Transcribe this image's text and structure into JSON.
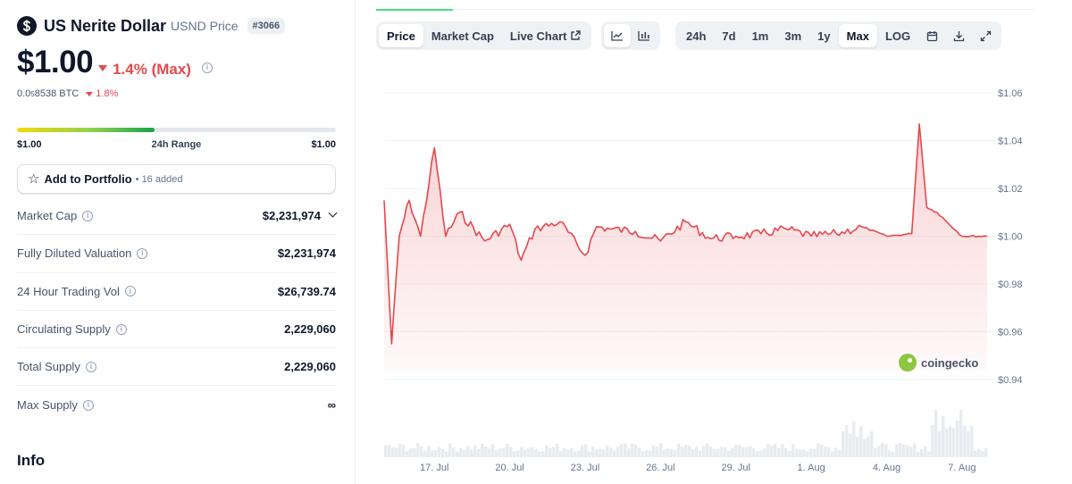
{
  "coin": {
    "name": "US Nerite Dollar",
    "symbol": "USND Price",
    "rank": "#3066",
    "price": "$1.00",
    "change": "1.4% (Max)",
    "btc_price_prefix": "0.0",
    "btc_price_sub": "5",
    "btc_price_suffix": "8538 BTC",
    "btc_change": "1.8%"
  },
  "range": {
    "low": "$1.00",
    "label": "24h Range",
    "high": "$1.00",
    "fill_fraction": 0.43
  },
  "portfolio": {
    "label": "Add to Portfolio",
    "count": "• 16 added"
  },
  "stats": [
    {
      "label": "Market Cap",
      "value": "$2,231,974",
      "expandable": true
    },
    {
      "label": "Fully Diluted Valuation",
      "value": "$2,231,974"
    },
    {
      "label": "24 Hour Trading Vol",
      "value": "$26,739.74"
    },
    {
      "label": "Circulating Supply",
      "value": "2,229,060"
    },
    {
      "label": "Total Supply",
      "value": "2,229,060"
    },
    {
      "label": "Max Supply",
      "value": "∞"
    }
  ],
  "info_title": "Info",
  "chart_tabs": [
    "Price",
    "Market Cap",
    "Live Chart"
  ],
  "active_tab": "Price",
  "ranges": [
    "24h",
    "7d",
    "1m",
    "3m",
    "1y",
    "Max",
    "LOG"
  ],
  "active_range": "Max",
  "icons": {
    "line_chart": "line-chart-icon",
    "candle_chart": "candlestick-icon",
    "calendar": "calendar-icon",
    "download": "download-icon",
    "expand": "expand-icon",
    "external": "external-link-icon"
  },
  "watermark": "coingecko",
  "colors": {
    "up_down_red": "#e5484d",
    "line": "#e5484d",
    "range_green": "#16a34a"
  },
  "chart_data": {
    "type": "area",
    "y_ticks": [
      "$1.06",
      "$1.04",
      "$1.02",
      "$1.00",
      "$0.98",
      "$0.96",
      "$0.94"
    ],
    "ylim": [
      0.94,
      1.06
    ],
    "x_ticks": [
      "17. Jul",
      "20. Jul",
      "23. Jul",
      "26. Jul",
      "29. Jul",
      "1. Aug",
      "4. Aug",
      "7. Aug"
    ],
    "x": [
      "Jul 15",
      "Jul 15",
      "Jul 15",
      "Jul 16",
      "Jul 16",
      "Jul 17",
      "Jul 17",
      "Jul 18",
      "Jul 19",
      "Jul 20",
      "Jul 20",
      "Jul 21",
      "Jul 22",
      "Jul 23",
      "Jul 23",
      "Jul 24",
      "Jul 25",
      "Jul 26",
      "Jul 27",
      "Jul 28",
      "Jul 29",
      "Jul 30",
      "Jul 31",
      "Aug 1",
      "Aug 2",
      "Aug 3",
      "Aug 4",
      "Aug 5",
      "Aug 5",
      "Aug 5",
      "Aug 6",
      "Aug 7",
      "Aug 8"
    ],
    "series": [
      {
        "values": [
          1.015,
          0.955,
          1.0,
          1.015,
          1.0,
          1.037,
          1.0,
          1.01,
          0.998,
          1.005,
          0.99,
          1.003,
          1.006,
          0.992,
          1.004,
          1.003,
          1.002,
          0.998,
          1.006,
          0.999,
          1.0,
          1.001,
          1.003,
          1.0,
          1.001,
          1.004,
          1.0,
          1.001,
          1.047,
          1.012,
          1.01,
          1.0,
          1.0
        ]
      }
    ],
    "volume_present": true,
    "grid": true
  }
}
